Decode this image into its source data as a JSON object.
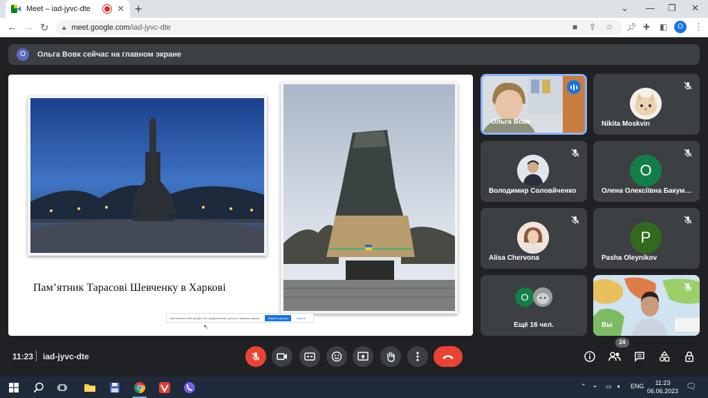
{
  "browser": {
    "tab_title": "Meet – iad-jyvc-dte",
    "url_host": "meet.google.com",
    "url_path": "/iad-jyvc-dte",
    "profile_letter": "O"
  },
  "banner": {
    "avatar_letter": "О",
    "text": "Ольга Вовк сейчас на главном экране"
  },
  "presentation": {
    "caption": "Пам’ятник Тарасові Шевченку в Харкові",
    "share_text": "Приложение meet.google.com предоставляет доступ к вашему экрану.",
    "share_stop": "Закрыть доступ",
    "share_hide": "Скрыть"
  },
  "participants": [
    {
      "name": "Ольга Вовк",
      "type": "video",
      "active": true
    },
    {
      "name": "Nikita Moskvin",
      "type": "photo",
      "muted": true
    },
    {
      "name": "Володимир Соловйченко",
      "type": "photo",
      "muted": true
    },
    {
      "name": "Олена Олексіївна Бакуменко",
      "type": "letter",
      "letter": "О",
      "color": "#137d48",
      "muted": true
    },
    {
      "name": "Alisa Chervona",
      "type": "photo",
      "muted": true
    },
    {
      "name": "Pasha Oleynikov",
      "type": "letter",
      "letter": "P",
      "color": "#33691e",
      "muted": true
    },
    {
      "name": "Ещё 16 чел.",
      "type": "more",
      "letter": "О"
    },
    {
      "name": "Вы",
      "type": "video",
      "muted": true
    }
  ],
  "bottombar": {
    "time": "11:23",
    "meeting_code": "iad-jyvc-dte",
    "participants_count": "24"
  },
  "taskbar": {
    "lang": "ENG",
    "time": "11:23",
    "date": "06.06.2023"
  },
  "colors": {
    "meet_bg": "#202124",
    "tile_bg": "#3c4043",
    "red": "#ea4335",
    "accent": "#8ab4f8"
  }
}
